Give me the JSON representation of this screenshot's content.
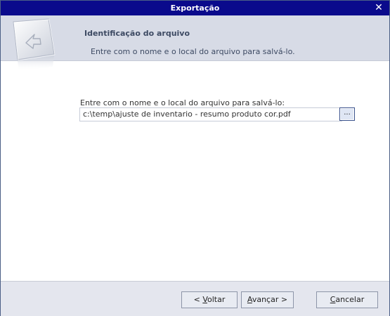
{
  "window": {
    "title": "Exportação",
    "close_glyph": "✕"
  },
  "header": {
    "heading": "Identificação do arquivo",
    "subtitle": "Entre com o nome e o local do arquivo para salvá-lo.",
    "icon": "document-arrow-icon"
  },
  "form": {
    "label": "Entre com o nome e o local do arquivo para salvá-lo:",
    "path_value": "c:\\temp\\ajuste de inventario - resumo produto cor.pdf",
    "browse_label": "..."
  },
  "buttons": {
    "back_prefix": "< ",
    "back_key": "V",
    "back_rest": "oltar",
    "next_prefix": "",
    "next_key": "A",
    "next_rest": "vançar >",
    "cancel_key": "C",
    "cancel_rest": "ancelar"
  },
  "colors": {
    "titlebar": "#0a0a8c",
    "header_bg": "#d7dbe6",
    "footer_bg": "#e4e6ee"
  }
}
